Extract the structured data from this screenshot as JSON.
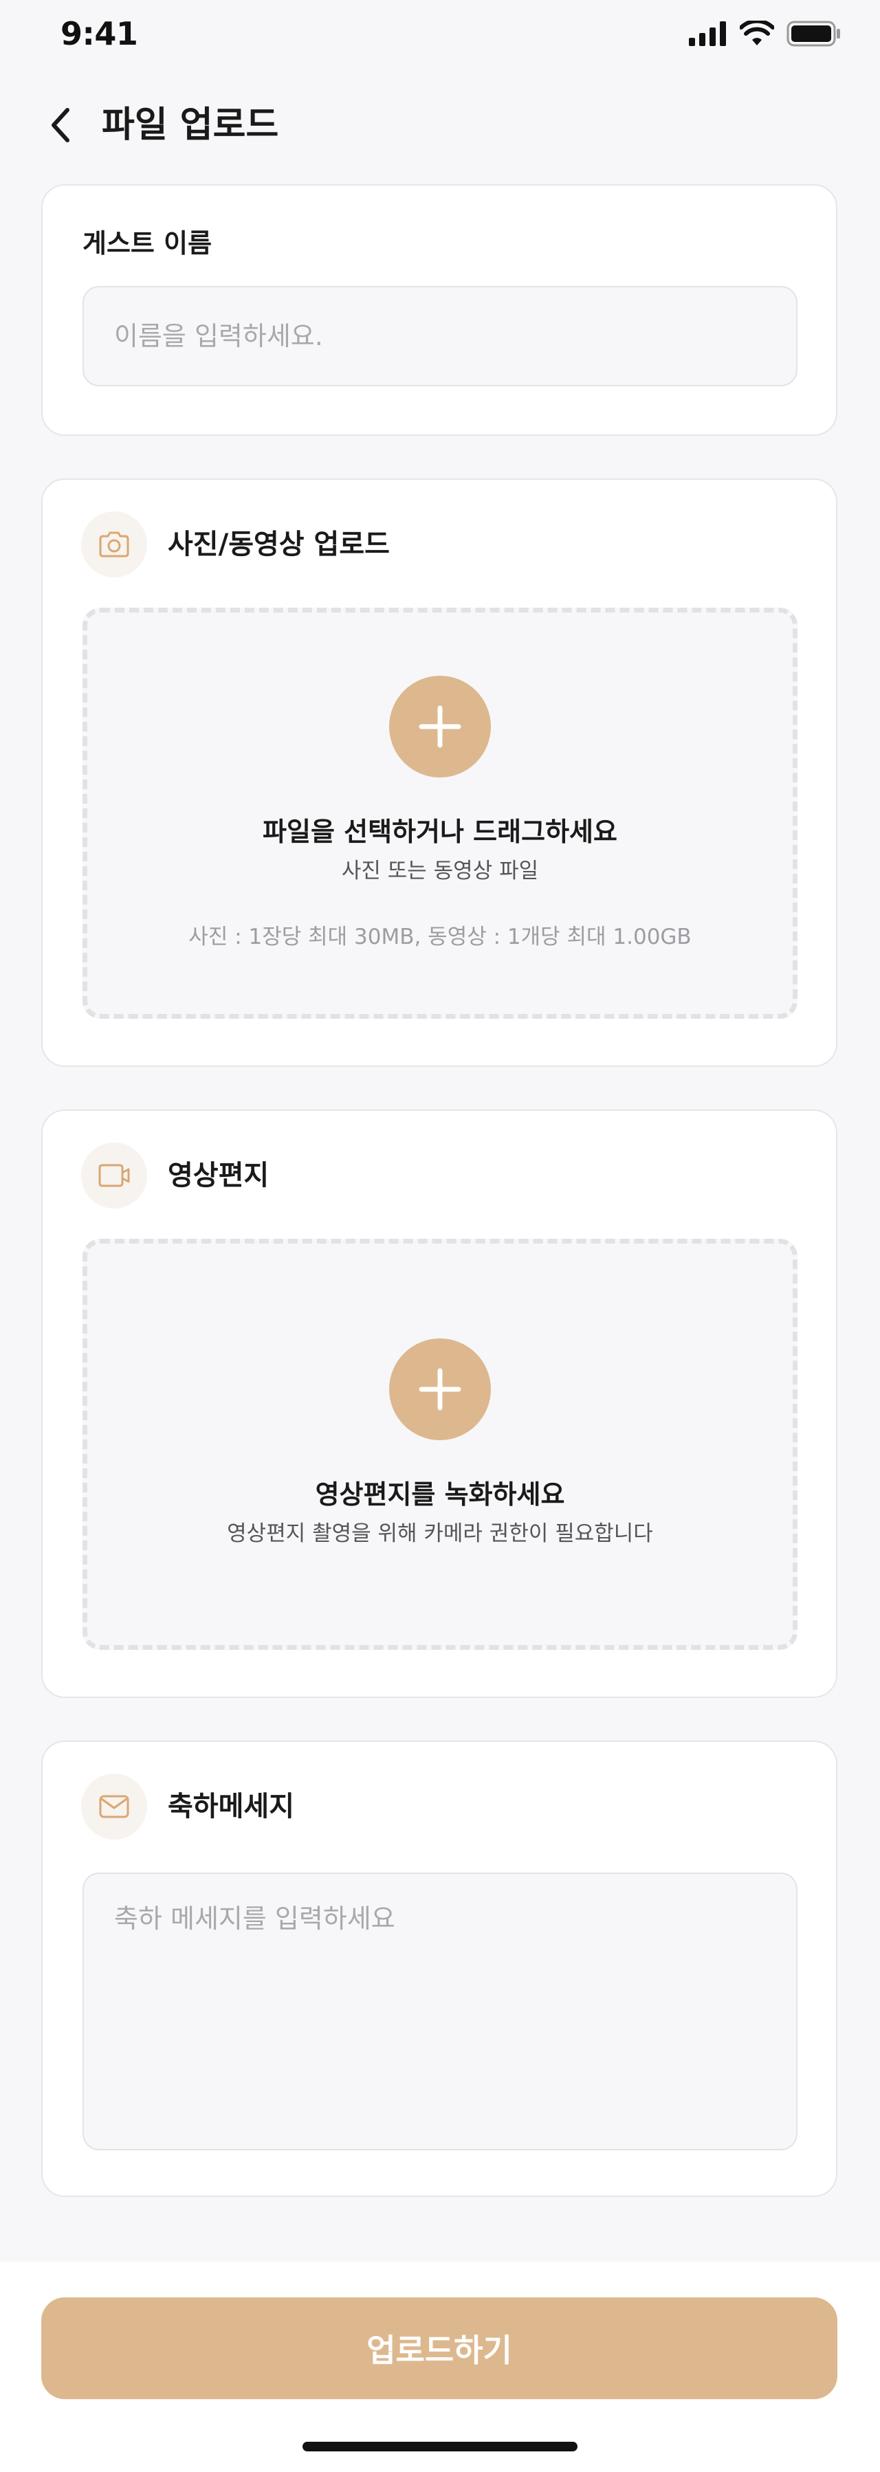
{
  "status_bar": {
    "time": "9:41"
  },
  "header": {
    "title": "파일 업로드"
  },
  "guest_name": {
    "label": "게스트 이름",
    "placeholder": "이름을 입력하세요.",
    "value": ""
  },
  "photo_upload": {
    "title": "사진/동영상 업로드",
    "icon": "camera-icon",
    "dropzone_title": "파일을 선택하거나 드래그하세요",
    "dropzone_subtitle": "사진 또는 동영상 파일",
    "limit_note": "사진 : 1장당 최대 30MB, 동영상 : 1개당 최대 1.00GB"
  },
  "video_letter": {
    "title": "영상편지",
    "icon": "video-camera-icon",
    "dropzone_title": "영상편지를 녹화하세요",
    "dropzone_subtitle": "영상편지 촬영을 위해 카메라 권한이 필요합니다"
  },
  "message": {
    "title": "축하메세지",
    "icon": "mail-icon",
    "placeholder": "축하 메세지를 입력하세요",
    "value": ""
  },
  "footer": {
    "upload_label": "업로드하기"
  },
  "colors": {
    "accent": "#DDB88E",
    "icon_accent": "#D9A774",
    "background": "#F7F7F9",
    "card": "#FFFFFF",
    "border": "#E6E6EA"
  }
}
